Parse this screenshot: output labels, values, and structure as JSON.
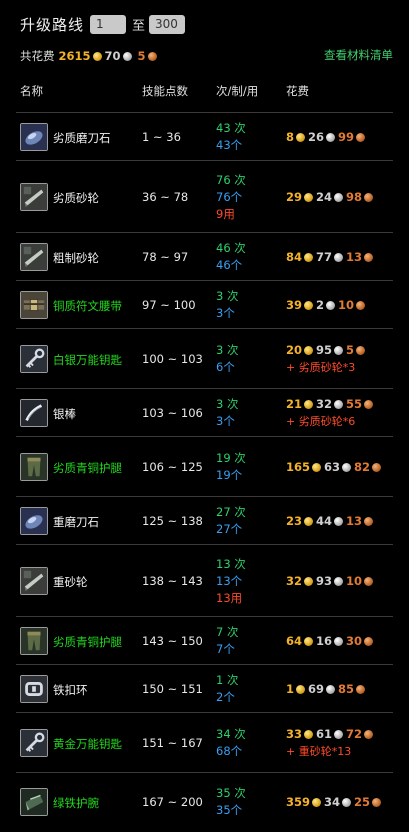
{
  "header": {
    "title": "升级路线",
    "level_from": "1",
    "level_to": "300",
    "to_label": "至",
    "total_label": "共花费",
    "total_gold": "2615",
    "total_silver": "70",
    "total_copper": "5",
    "materials_link": "查看材料清单"
  },
  "columns": {
    "name": "名称",
    "range": "技能点数",
    "times": "次/制/用",
    "cost": "花费"
  },
  "rows": [
    {
      "name": "劣质磨刀石",
      "color": "white",
      "icon": "whetstone-icon",
      "range": "1 ~ 36",
      "t1": "43 次",
      "t2": "43个",
      "t3": "",
      "gold": "8",
      "silver": "26",
      "copper": "99",
      "extra": ""
    },
    {
      "name": "劣质砂轮",
      "color": "white",
      "icon": "grinding-stone-icon",
      "range": "36 ~ 78",
      "t1": "76 次",
      "t2": "76个",
      "t3": "9用",
      "gold": "29",
      "silver": "24",
      "copper": "98",
      "extra": ""
    },
    {
      "name": "粗制砂轮",
      "color": "white",
      "icon": "grinding-stone-icon",
      "range": "78 ~ 97",
      "t1": "46 次",
      "t2": "46个",
      "t3": "",
      "gold": "84",
      "silver": "77",
      "copper": "13",
      "extra": ""
    },
    {
      "name": "铜质符文腰带",
      "color": "green",
      "icon": "belt-icon",
      "range": "97 ~ 100",
      "t1": "3 次",
      "t2": "3个",
      "t3": "",
      "gold": "39",
      "silver": "2",
      "copper": "10",
      "extra": ""
    },
    {
      "name": "白银万能钥匙",
      "color": "green",
      "icon": "key-icon",
      "range": "100 ~ 103",
      "t1": "3 次",
      "t2": "6个",
      "t3": "",
      "gold": "20",
      "silver": "95",
      "copper": "5",
      "extra": "+ 劣质砂轮*3"
    },
    {
      "name": "银棒",
      "color": "white",
      "icon": "rod-icon",
      "range": "103 ~ 106",
      "t1": "3 次",
      "t2": "3个",
      "t3": "",
      "gold": "21",
      "silver": "32",
      "copper": "55",
      "extra": "+ 劣质砂轮*6"
    },
    {
      "name": "劣质青铜护腿",
      "color": "green",
      "icon": "leggings-icon",
      "range": "106 ~ 125",
      "t1": "19 次",
      "t2": "19个",
      "t3": "",
      "gold": "165",
      "silver": "63",
      "copper": "82",
      "extra": ""
    },
    {
      "name": "重磨刀石",
      "color": "white",
      "icon": "whetstone-icon",
      "range": "125 ~ 138",
      "t1": "27 次",
      "t2": "27个",
      "t3": "",
      "gold": "23",
      "silver": "44",
      "copper": "13",
      "extra": ""
    },
    {
      "name": "重砂轮",
      "color": "white",
      "icon": "grinding-stone-icon",
      "range": "138 ~ 143",
      "t1": "13 次",
      "t2": "13个",
      "t3": "13用",
      "gold": "32",
      "silver": "93",
      "copper": "10",
      "extra": ""
    },
    {
      "name": "劣质青铜护腿",
      "color": "green",
      "icon": "leggings-icon",
      "range": "143 ~ 150",
      "t1": "7 次",
      "t2": "7个",
      "t3": "",
      "gold": "64",
      "silver": "16",
      "copper": "30",
      "extra": ""
    },
    {
      "name": "铁扣环",
      "color": "white",
      "icon": "buckle-icon",
      "range": "150 ~ 151",
      "t1": "1 次",
      "t2": "2个",
      "t3": "",
      "gold": "1",
      "silver": "69",
      "copper": "85",
      "extra": ""
    },
    {
      "name": "黄金万能钥匙",
      "color": "green",
      "icon": "key-icon",
      "range": "151 ~ 167",
      "t1": "34 次",
      "t2": "68个",
      "t3": "",
      "gold": "33",
      "silver": "61",
      "copper": "72",
      "extra": "+ 重砂轮*13"
    },
    {
      "name": "绿铁护腕",
      "color": "green",
      "icon": "bracer-icon",
      "range": "167 ~ 200",
      "t1": "35 次",
      "t2": "35个",
      "t3": "",
      "gold": "359",
      "silver": "34",
      "copper": "25",
      "extra": ""
    }
  ],
  "colors": {
    "green_item": "#22d81e",
    "gold": "#f3b22a",
    "copper": "#e07a35",
    "blue": "#3b9ef0",
    "red": "#ff4a2a",
    "link": "#3fd06e"
  }
}
